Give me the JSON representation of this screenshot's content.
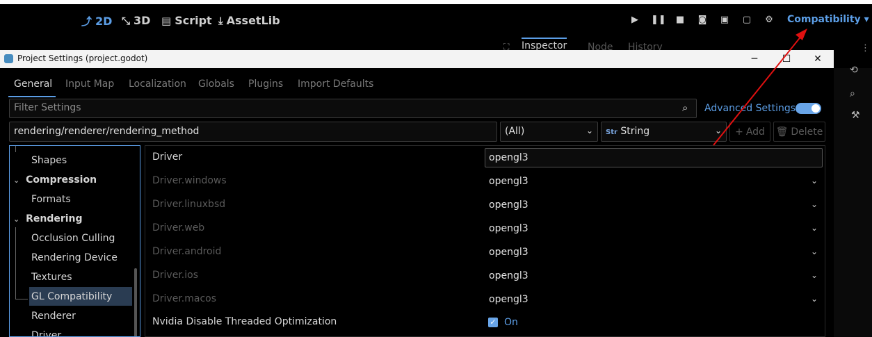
{
  "editor": {
    "modes": [
      {
        "label": "2D",
        "icon": "2d-icon",
        "active": true
      },
      {
        "label": "3D",
        "icon": "3d-icon",
        "active": false
      },
      {
        "label": "Script",
        "icon": "script-icon",
        "active": false
      },
      {
        "label": "AssetLib",
        "icon": "assetlib-icon",
        "active": false
      }
    ],
    "renderer": "Compatibility",
    "renderer_arrow": "▾",
    "dock_tabs": [
      "Inspector",
      "Node",
      "History"
    ],
    "accent": "#5c9ee6"
  },
  "dialog": {
    "title": "Project Settings (project.godot)",
    "tabs": [
      "General",
      "Input Map",
      "Localization",
      "Globals",
      "Plugins",
      "Import Defaults"
    ],
    "filter_placeholder": "Filter Settings",
    "advanced_label": "Advanced Settings",
    "advanced_enabled": true,
    "path_value": "rendering/renderer/rendering_method",
    "scope_value": "(All)",
    "type_value": "String",
    "add_label": "Add",
    "delete_label": "Delete"
  },
  "tree": [
    {
      "label": "Shapes",
      "bold": false,
      "arrow": ""
    },
    {
      "label": "Compression",
      "bold": true,
      "arrow": "⌄"
    },
    {
      "label": "Formats",
      "bold": false,
      "arrow": ""
    },
    {
      "label": "Rendering",
      "bold": true,
      "arrow": "⌄"
    },
    {
      "label": "Occlusion Culling",
      "bold": false,
      "arrow": ""
    },
    {
      "label": "Rendering Device",
      "bold": false,
      "arrow": ""
    },
    {
      "label": "Textures",
      "bold": false,
      "arrow": ""
    },
    {
      "label": "GL Compatibility",
      "bold": false,
      "arrow": "",
      "selected": true
    },
    {
      "label": "Renderer",
      "bold": false,
      "arrow": ""
    },
    {
      "label": "Driver",
      "bold": false,
      "arrow": ""
    }
  ],
  "properties": [
    {
      "name": "Driver",
      "value": "opengl3",
      "dim": false,
      "editable": true
    },
    {
      "name": "Driver.windows",
      "value": "opengl3",
      "dim": true,
      "dropdown": true
    },
    {
      "name": "Driver.linuxbsd",
      "value": "opengl3",
      "dim": true,
      "dropdown": true
    },
    {
      "name": "Driver.web",
      "value": "opengl3",
      "dim": true,
      "dropdown": true
    },
    {
      "name": "Driver.android",
      "value": "opengl3",
      "dim": true,
      "dropdown": true
    },
    {
      "name": "Driver.ios",
      "value": "opengl3",
      "dim": true,
      "dropdown": true
    },
    {
      "name": "Driver.macos",
      "value": "opengl3",
      "dim": true,
      "dropdown": true
    }
  ],
  "nvidia": {
    "name": "Nvidia Disable Threaded Optimization",
    "value": "On",
    "checked": true
  },
  "annotation_color": "#e01010"
}
